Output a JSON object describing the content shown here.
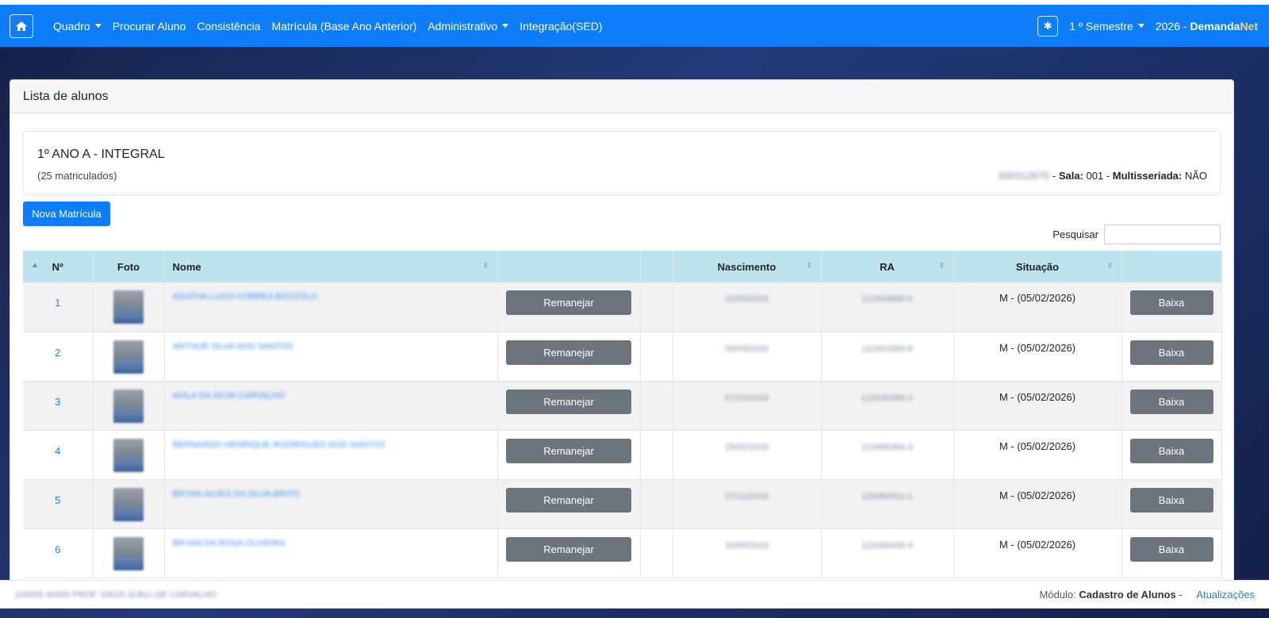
{
  "navbar": {
    "items": [
      {
        "label": "Quadro",
        "dropdown": true
      },
      {
        "label": "Procurar Aluno",
        "dropdown": false
      },
      {
        "label": "Consistência",
        "dropdown": false
      },
      {
        "label": "Matrícula (Base Ano Anterior)",
        "dropdown": false
      },
      {
        "label": "Administrativo",
        "dropdown": true
      },
      {
        "label": "Integração(SED)",
        "dropdown": false
      }
    ],
    "semester": "1 º Semestre",
    "year_prefix": "2026 - ",
    "brand_a": "Demanda",
    "brand_b": "Net",
    "accent": "#0d7dfa"
  },
  "card": {
    "title": "Lista de alunos",
    "class_name": "1º ANO A - INTEGRAL",
    "enrolled": "(25 matriculados)",
    "class_code": "300312670",
    "sala_label": "Sala:",
    "sala_value": "001",
    "multi_label": "Multisseriada:",
    "multi_value": "NÃO",
    "new_button": "Nova Matrícula",
    "search_label": "Pesquisar",
    "search_value": ""
  },
  "table": {
    "headers": [
      "Nº",
      "Foto",
      "Nome",
      "",
      "",
      "Nascimento",
      "RA",
      "Situação",
      ""
    ],
    "rows": [
      {
        "n": "1",
        "name": "AGATHA LUIZA CORREA BOZZOLO",
        "birth": "11/05/2019",
        "ra": "121943980-0",
        "status": "M - (05/02/2026)"
      },
      {
        "n": "2",
        "name": "ARTHUR SILVA DOS SANTOS",
        "birth": "09/03/2020",
        "ra": "122403350-8",
        "status": "M - (05/02/2026)"
      },
      {
        "n": "3",
        "name": "AVILA DA SILVA CARVALHO",
        "birth": "07/10/2019",
        "ra": "122030080-2",
        "status": "M - (05/02/2026)"
      },
      {
        "n": "4",
        "name": "BERNARDO HENRIQUE RODRIGUES DOS SANTOS",
        "birth": "25/02/2020",
        "ra": "123465364-3",
        "status": "M - (05/02/2026)"
      },
      {
        "n": "5",
        "name": "BRYAN ALVES DA SILVA BRITO",
        "birth": "07/11/2018",
        "ra": "126383501-1",
        "status": "M - (05/02/2026)"
      },
      {
        "n": "6",
        "name": "BRYAN DA ROSA OLIVEIRA",
        "birth": "10/05/2019",
        "ra": "122060435-9",
        "status": "M - (05/02/2026)"
      }
    ],
    "move_label": "Remanejar",
    "drop_label": "Baixa"
  },
  "footer": {
    "user": "104059 40455 PROF. 03025 SUELI DE CARVALHO",
    "module_label": "Módulo:",
    "module_name": "Cadastro de Alunos",
    "separator": " - ",
    "updates_link": "Atualizações"
  }
}
